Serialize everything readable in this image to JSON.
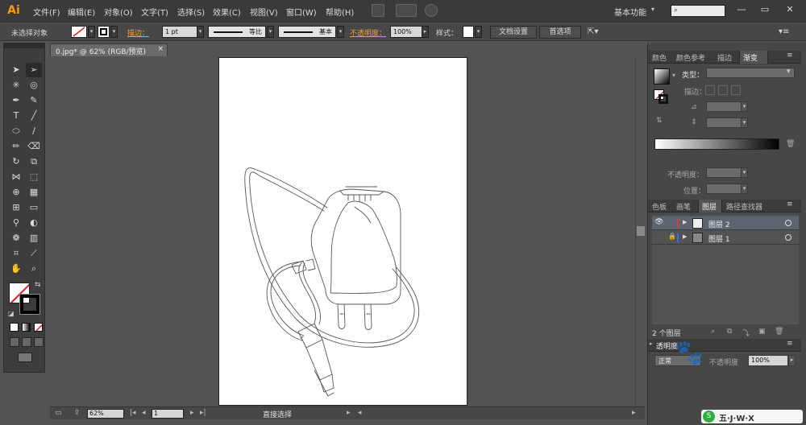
{
  "app": {
    "logo": "Ai"
  },
  "menu": [
    "文件(F)",
    "编辑(E)",
    "对象(O)",
    "文字(T)",
    "选择(S)",
    "效果(C)",
    "视图(V)",
    "窗口(W)",
    "帮助(H)"
  ],
  "workspace": {
    "label": "基本功能",
    "caret": "▾"
  },
  "window_buttons": [
    "—",
    "▭",
    "✕"
  ],
  "control_bar": {
    "selection_label": "未选择对象",
    "stroke_label": "描边：",
    "stroke_weight": "1 pt",
    "profile_label": "等比",
    "brush_label": "基本",
    "opacity_label": "不透明度：",
    "opacity_value": "100%",
    "style_label": "样式：",
    "doc_setup": "文档设置",
    "preferences": "首选项"
  },
  "document": {
    "tab_title": "0.jpg* @ 62% (RGB/预览)",
    "close": "×"
  },
  "status_bar": {
    "zoom": "62%",
    "page": "1",
    "tool_name": "直接选择"
  },
  "panels": {
    "top_tabs": [
      "颜色",
      "颜色参考",
      "描边",
      "渐变"
    ],
    "active_top_tab": "渐变",
    "gradient": {
      "type_label": "类型：",
      "stroke_label": "描边：",
      "opacity_label": "不透明度：",
      "position_label": "位置："
    },
    "layers_tabs": [
      "色板",
      "画笔",
      "图层",
      "路径查找器"
    ],
    "active_layers_tab": "图层",
    "layers": [
      {
        "name": "图层 2",
        "color": "#e0383b",
        "selected": true,
        "visible": true,
        "locked": false
      },
      {
        "name": "图层 1",
        "color": "#3a6ee8",
        "selected": false,
        "visible": false,
        "locked": true
      }
    ],
    "layer_count": "2 个图层",
    "transparency_tab": "透明度",
    "transparency_blend": "正常",
    "transparency_opacity_label": "不透明度",
    "transparency_value": "100%"
  },
  "watermark": {
    "text": "五·J·W·X"
  },
  "icons": {
    "eye": "eye-icon",
    "lock": "lock-icon",
    "search": "search-icon"
  }
}
